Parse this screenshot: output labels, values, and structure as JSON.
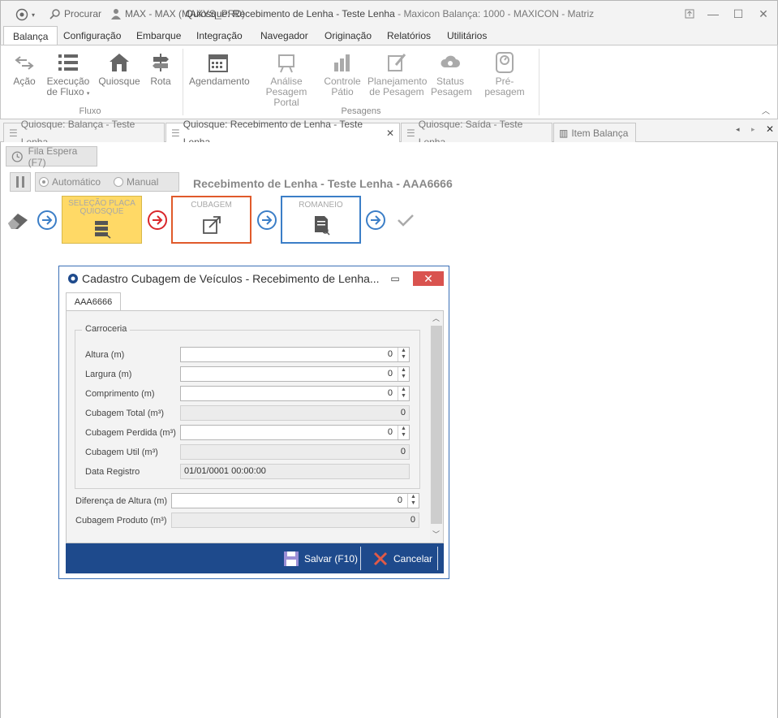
{
  "titlebar": {
    "search_label": "Procurar",
    "user_label": "MAX - MAX (MAXYS_PRD)",
    "title": "Quiosque: Recebimento de Lenha - Teste Lenha",
    "app": "- Maxicon Balança: 1000 - MAXICON - Matriz"
  },
  "menu": [
    "Balança",
    "Configuração",
    "Embarque",
    "Integração",
    "Navegador",
    "Originação",
    "Relatórios",
    "Utilitários"
  ],
  "ribbon": {
    "acao": "Ação",
    "execucao_line1": "Execução",
    "execucao_line2": "de Fluxo",
    "quiosque": "Quiosque",
    "rota": "Rota",
    "agendamento": "Agendamento",
    "analise_line1": "Análise",
    "analise_line2": "Pesagem Portal",
    "controle_line1": "Controle",
    "controle_line2": "Pátio",
    "planejamento_line1": "Planejamento",
    "planejamento_line2": "de Pesagem",
    "status_line1": "Status",
    "status_line2": "Pesagem",
    "prepesagem": "Pré-pesagem",
    "group_fluxo": "Fluxo",
    "group_pesagens": "Pesagens"
  },
  "doc_tabs": [
    "Quiosque: Balança - Teste Lenha",
    "Quiosque: Recebimento de Lenha - Teste Lenha",
    "Quiosque: Saída - Teste Lenha",
    "Item Balança"
  ],
  "toolbar": {
    "fila_espera": "Fila Espera (F7)",
    "automatico": "Automático",
    "manual": "Manual"
  },
  "heading": "Recebimento de Lenha - Teste Lenha - AAA6666",
  "steps": {
    "selecao_line1": "SELEÇÃO PLACA",
    "selecao_line2": "QUIOSQUE",
    "cubagem": "CUBAGEM",
    "romaneio": "ROMANEIO"
  },
  "colors": {
    "step_yellow": "#ffd966",
    "step_orange": "#e05a2b",
    "step_blue": "#3b7ec7",
    "arrow_red": "#d9262b",
    "footer_blue": "#1e4a8c"
  },
  "dialog": {
    "title": "Cadastro Cubagem de Veículos - Recebimento de Lenha...",
    "tab": "AAA6666",
    "group": "Carroceria",
    "fields": {
      "altura_label": "Altura (m)",
      "altura_value": "0",
      "largura_label": "Largura (m)",
      "largura_value": "0",
      "comprimento_label": "Comprimento (m)",
      "comprimento_value": "0",
      "cubagem_total_label": "Cubagem Total (m³)",
      "cubagem_total_value": "0",
      "cubagem_perdida_label": "Cubagem Perdida (m³)",
      "cubagem_perdida_value": "0",
      "cubagem_util_label": "Cubagem Util (m³)",
      "cubagem_util_value": "0",
      "data_registro_label": "Data Registro",
      "data_registro_value": "01/01/0001 00:00:00",
      "diferenca_altura_label": "Diferença de Altura (m)",
      "diferenca_altura_value": "0",
      "cubagem_produto_label": "Cubagem Produto (m³)",
      "cubagem_produto_value": "0"
    },
    "salvar": "Salvar (F10)",
    "cancelar": "Cancelar"
  }
}
